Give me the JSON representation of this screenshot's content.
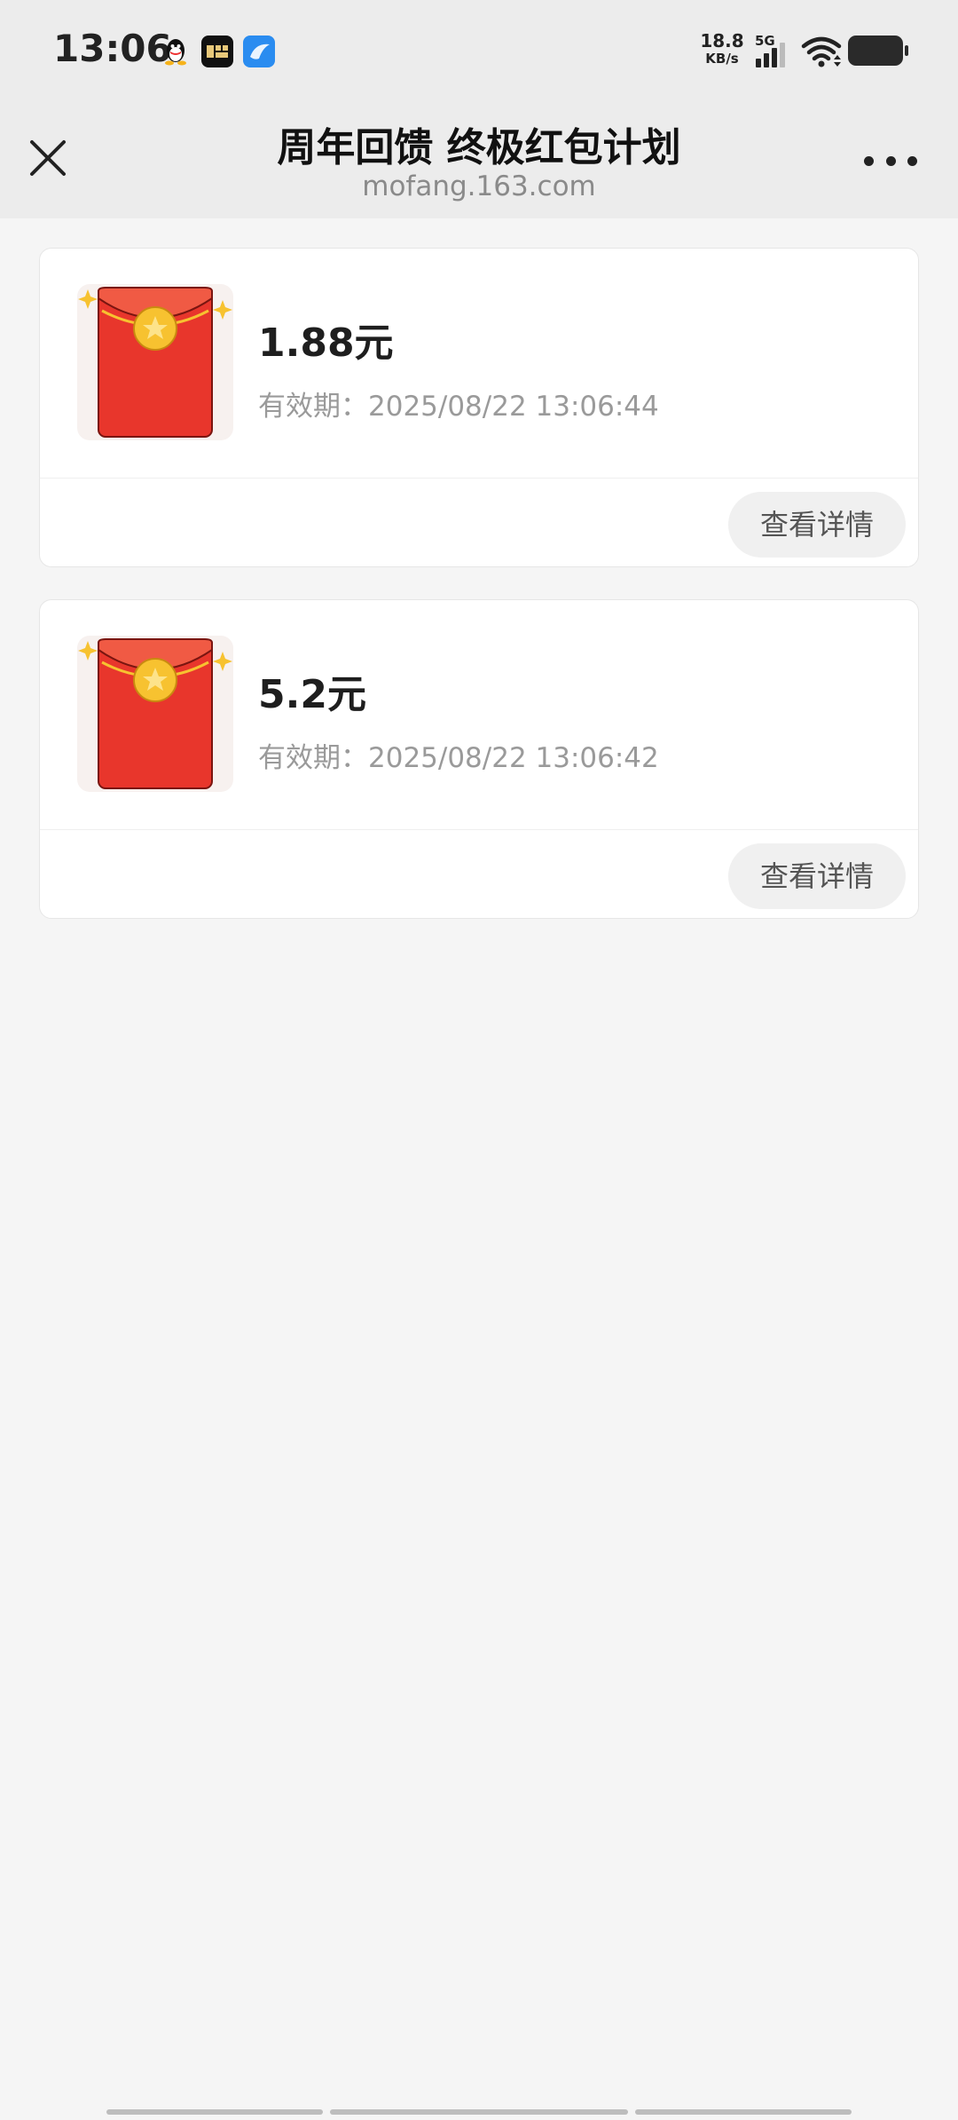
{
  "status_bar": {
    "time": "13:06",
    "net_speed_value": "18.8",
    "net_speed_unit": "KB/s",
    "network_type": "5G",
    "icons": [
      "qq-icon",
      "news-app-icon",
      "blue-app-icon",
      "signal-icon",
      "wifi-icon",
      "battery-icon"
    ]
  },
  "header": {
    "title": "周年回馈 终极红包计划",
    "subtitle": "mofang.163.com",
    "close_icon": "close-icon",
    "more_icon": "more-icon"
  },
  "cards": [
    {
      "amount": "1.88元",
      "expiry": "有效期：2025/08/22 13:06:44",
      "button_label": "查看详情",
      "icon": "red-envelope-icon"
    },
    {
      "amount": "5.2元",
      "expiry": "有效期：2025/08/22 13:06:42",
      "button_label": "查看详情",
      "icon": "red-envelope-icon"
    }
  ],
  "colors": {
    "page_background": "#f5f5f5",
    "header_background": "#ececec",
    "envelope_red": "#e8362c",
    "coin_gold": "#f7c230",
    "button_background": "#f0f0f0"
  }
}
